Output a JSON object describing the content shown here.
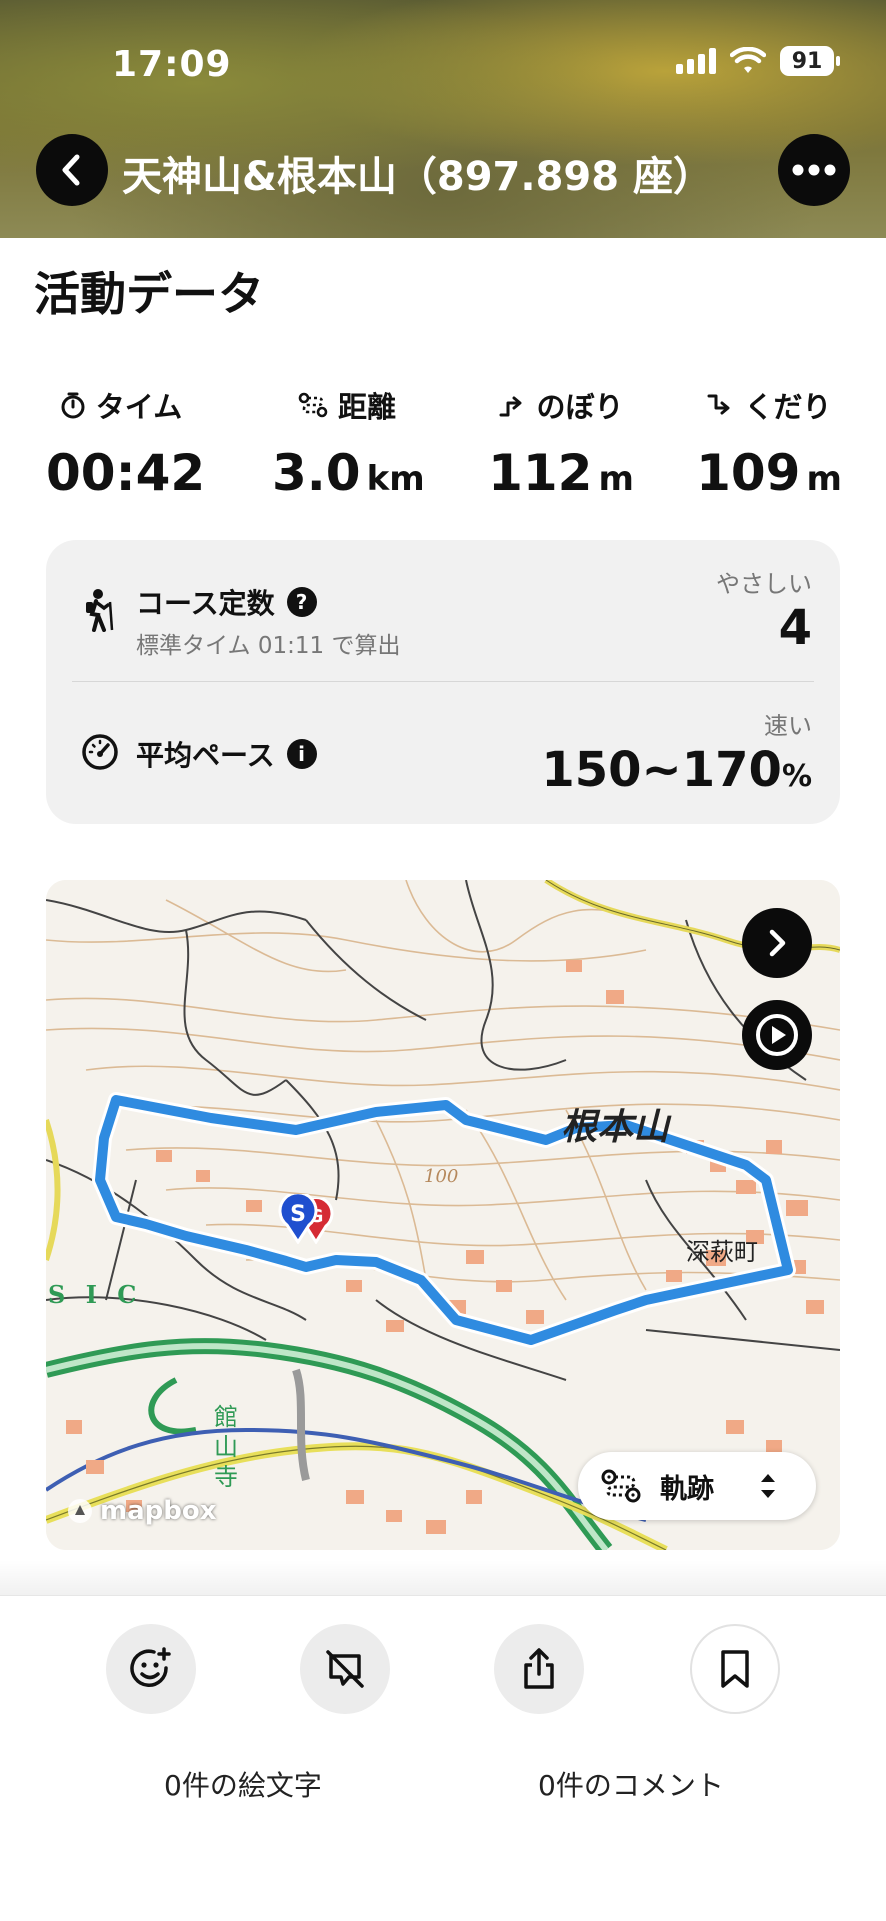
{
  "status": {
    "time": "17:09",
    "battery": "91"
  },
  "header": {
    "title": "天神山&根本山（897.898 座）"
  },
  "section": {
    "title": "活動データ"
  },
  "stats": [
    {
      "label": "タイム",
      "value": "00:42",
      "unit": "",
      "icon": "stopwatch-icon"
    },
    {
      "label": "距離",
      "value": "3.0",
      "unit": "km",
      "icon": "route-icon"
    },
    {
      "label": "のぼり",
      "value": "112",
      "unit": "m",
      "icon": "ascent-icon"
    },
    {
      "label": "くだり",
      "value": "109",
      "unit": "m",
      "icon": "descent-icon"
    }
  ],
  "course": {
    "label": "コース定数",
    "sub": "標準タイム 01:11 で算出",
    "difficulty": "やさしい",
    "value": "4"
  },
  "pace": {
    "label": "平均ペース",
    "speed": "速い",
    "value": "150~170",
    "unit": "%"
  },
  "map": {
    "mountain_label": "根本山",
    "town_label": "深萩町",
    "sic_label": "S I C",
    "station_label": "館山寺",
    "contour_label": "100",
    "brand": "mapbox",
    "track_button": "軌跡"
  },
  "bottom": {
    "emoji_count": "0件の絵文字",
    "comment_count": "0件のコメント"
  },
  "colors": {
    "route": "#2f8be0",
    "header": "#6f6c3a",
    "card": "#f1f1f1"
  }
}
